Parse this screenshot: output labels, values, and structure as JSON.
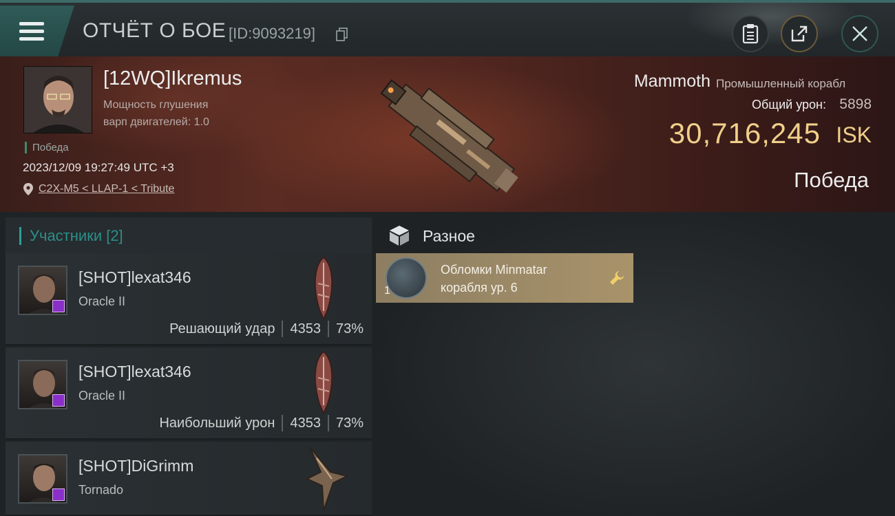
{
  "header": {
    "title": "ОТЧЁТ О БОЕ",
    "report_id": "[ID:9093219]"
  },
  "victim": {
    "name": "[12WQ]Ikremus",
    "stat_line1": "Мощность глушения",
    "stat_line2": "варп двигателей:  1.0",
    "outcome_tag": "Победа",
    "datetime": "2023/12/09 19:27:49 UTC +3",
    "location": "C2X-M5 < LLAP-1 < Tribute",
    "ship_name": "Mammoth",
    "ship_class": "Промышленный корабл",
    "total_damage_label": "Общий урон:",
    "total_damage": "5898",
    "isk_value": "30,716,245",
    "isk_unit": "ISK",
    "result": "Победа"
  },
  "participants": {
    "title": "Участники [2]",
    "rows": [
      {
        "name": "[SHOT]lexat346",
        "ship": "Oracle II",
        "role": "Решающий удар",
        "damage": "4353",
        "percent": "73%"
      },
      {
        "name": "[SHOT]lexat346",
        "ship": "Oracle II",
        "role": "Наибольший урон",
        "damage": "4353",
        "percent": "73%"
      },
      {
        "name": "[SHOT]DiGrimm",
        "ship": "Tornado",
        "role": "",
        "damage": "",
        "percent": ""
      }
    ]
  },
  "misc": {
    "title": "Разное",
    "items": [
      {
        "qty": "1",
        "name_line1": "Обломки Minmatar",
        "name_line2": "корабля ур. 6"
      }
    ]
  },
  "colors": {
    "accent_teal": "#2f9e98",
    "isk_gold": "#f0cf8a",
    "loot_card": "#a8936a",
    "badge_purple": "#8a2fc9"
  }
}
